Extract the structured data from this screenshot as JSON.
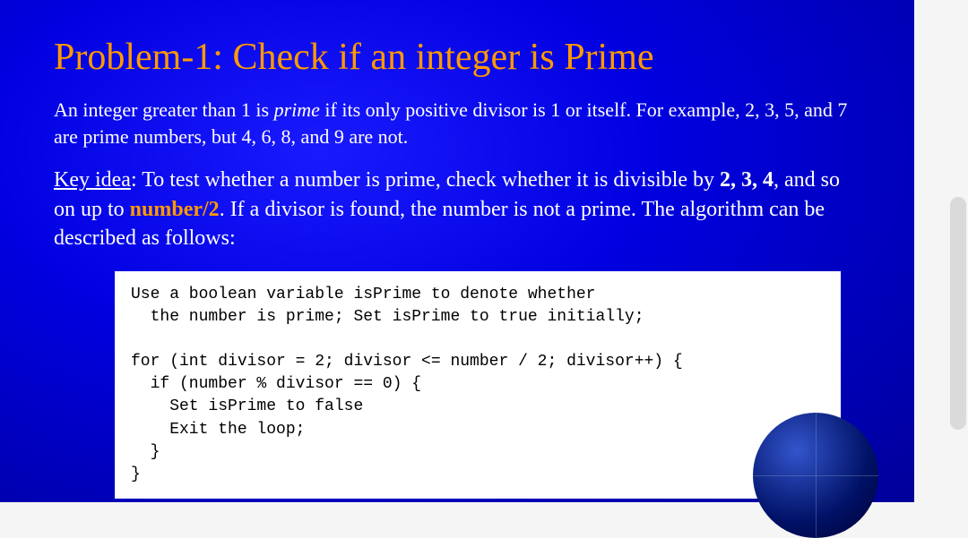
{
  "slide": {
    "title": "Problem-1: Check if an integer is Prime",
    "description_part1": "An integer greater than 1 is ",
    "description_prime": "prime",
    "description_part2": " if its only positive divisor is 1 or itself. For example, 2, 3, 5, and 7 are prime numbers, but 4, 6, 8, and 9 are not.",
    "key_idea_label": "Key idea",
    "key_idea_part1": ": To test whether a number is prime, check whether it is divisible by ",
    "key_idea_bold1": "2, 3, 4",
    "key_idea_part2": ", and so on up to ",
    "key_idea_highlight": "number/2",
    "key_idea_part3": ". If a divisor is found, the number is not a prime. The algorithm can be described as follows:",
    "code": "Use a boolean variable isPrime to denote whether\n  the number is prime; Set isPrime to true initially;\n\nfor (int divisor = 2; divisor <= number / 2; divisor++) {\n  if (number % divisor == 0) {\n    Set isPrime to false\n    Exit the loop;\n  }\n}"
  }
}
